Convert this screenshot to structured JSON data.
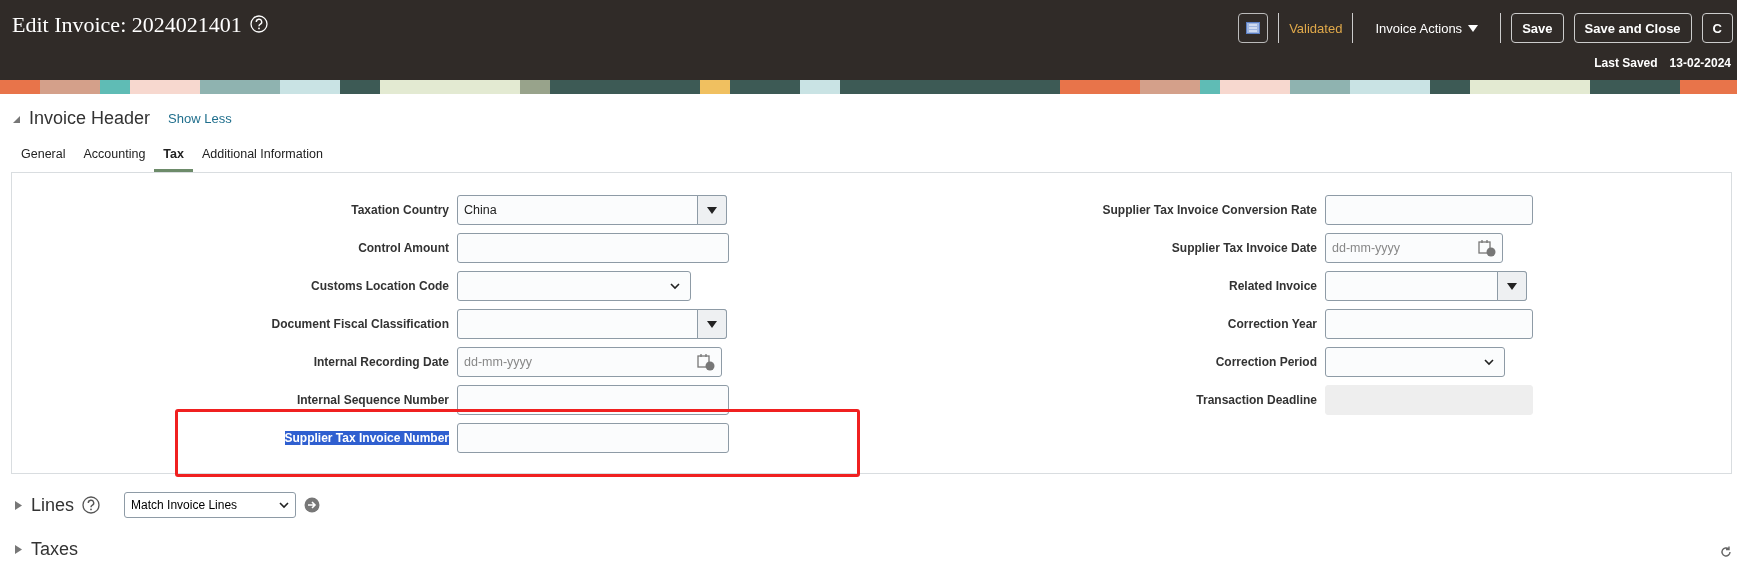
{
  "page_header": {
    "title": "Edit Invoice: 2024021401",
    "status": "Validated",
    "actions_menu": "Invoice Actions",
    "buttons": [
      "Save",
      "Save and Close",
      "C"
    ],
    "last_saved_label": "Last Saved",
    "last_saved_value": "13-02-2024"
  },
  "invoice_header": {
    "title": "Invoice Header",
    "expanded": true,
    "toggle_link": "Show Less",
    "tabs": [
      {
        "label": "General",
        "selected": false
      },
      {
        "label": "Accounting",
        "selected": false
      },
      {
        "label": "Tax",
        "selected": true
      },
      {
        "label": "Additional Information",
        "selected": false
      }
    ],
    "left_fields": [
      {
        "label": "Taxation Country",
        "kind": "combo",
        "value": "China"
      },
      {
        "label": "Control Amount",
        "kind": "text"
      },
      {
        "label": "Customs Location Code",
        "kind": "choice"
      },
      {
        "label": "Document Fiscal Classification",
        "kind": "combo"
      },
      {
        "label": "Internal Recording Date",
        "kind": "date",
        "placeholder": "dd-mm-yyyy"
      },
      {
        "label": "Internal Sequence Number",
        "kind": "text"
      },
      {
        "label": "Supplier Tax Invoice Number",
        "kind": "text",
        "highlighted": true,
        "outlined": true
      }
    ],
    "right_fields": [
      {
        "label": "Supplier Tax Invoice Conversion Rate",
        "kind": "text"
      },
      {
        "label": "Supplier Tax Invoice Date",
        "kind": "date",
        "placeholder": "dd-mm-yyyy"
      },
      {
        "label": "Related Invoice",
        "kind": "combo"
      },
      {
        "label": "Correction Year",
        "kind": "text"
      },
      {
        "label": "Correction Period",
        "kind": "choice"
      },
      {
        "label": "Transaction Deadline",
        "kind": "readonly"
      }
    ]
  },
  "sections": [
    {
      "title": "Lines",
      "expanded": false,
      "help": true,
      "select_value": "Match Invoice Lines"
    },
    {
      "title": "Taxes",
      "expanded": false,
      "help": false
    }
  ]
}
